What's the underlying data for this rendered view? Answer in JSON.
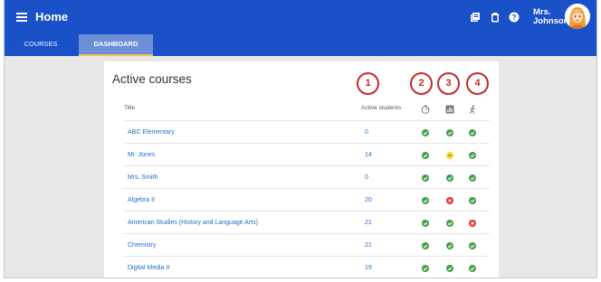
{
  "header": {
    "title": "Home",
    "user_first": "Mrs.",
    "user_last": "Johnson",
    "icons": [
      "menu-icon",
      "library-icon",
      "clipboard-icon",
      "help-icon",
      "avatar"
    ]
  },
  "tabs": [
    {
      "label": "COURSES",
      "active": false
    },
    {
      "label": "DASHBOARD",
      "active": true
    }
  ],
  "card": {
    "title": "Active courses",
    "columns": {
      "title": "Title",
      "students": "Active students",
      "icon_cols": [
        "timer-icon",
        "bar-chart-icon",
        "walking-icon"
      ]
    },
    "callouts": [
      "1",
      "2",
      "3",
      "4"
    ]
  },
  "rows": [
    {
      "title": "ABC Elementary",
      "students": "0",
      "status": [
        "ok",
        "ok",
        "ok"
      ]
    },
    {
      "title": "Mr. Jones",
      "students": "14",
      "status": [
        "ok",
        "warn",
        "ok"
      ]
    },
    {
      "title": "Mrs. Smith",
      "students": "0",
      "status": [
        "ok",
        "ok",
        "ok"
      ]
    },
    {
      "title": "Algebra II",
      "students": "20",
      "status": [
        "ok",
        "error",
        "ok"
      ]
    },
    {
      "title": "American Studies (History and Language Arts)",
      "students": "21",
      "status": [
        "ok",
        "ok",
        "error"
      ]
    },
    {
      "title": "Chemistry",
      "students": "21",
      "status": [
        "ok",
        "ok",
        "ok"
      ]
    },
    {
      "title": "Digital Media II",
      "students": "19",
      "status": [
        "ok",
        "ok",
        "ok"
      ]
    }
  ],
  "colors": {
    "primary": "#1a50c8",
    "tab_active_bg": "#6e8fd8",
    "tab_indicator": "#f3c14b",
    "link": "#1e6fc4",
    "ok": "#43a047",
    "warn": "#fdd835",
    "error": "#e53935",
    "callout": "#c62828"
  }
}
